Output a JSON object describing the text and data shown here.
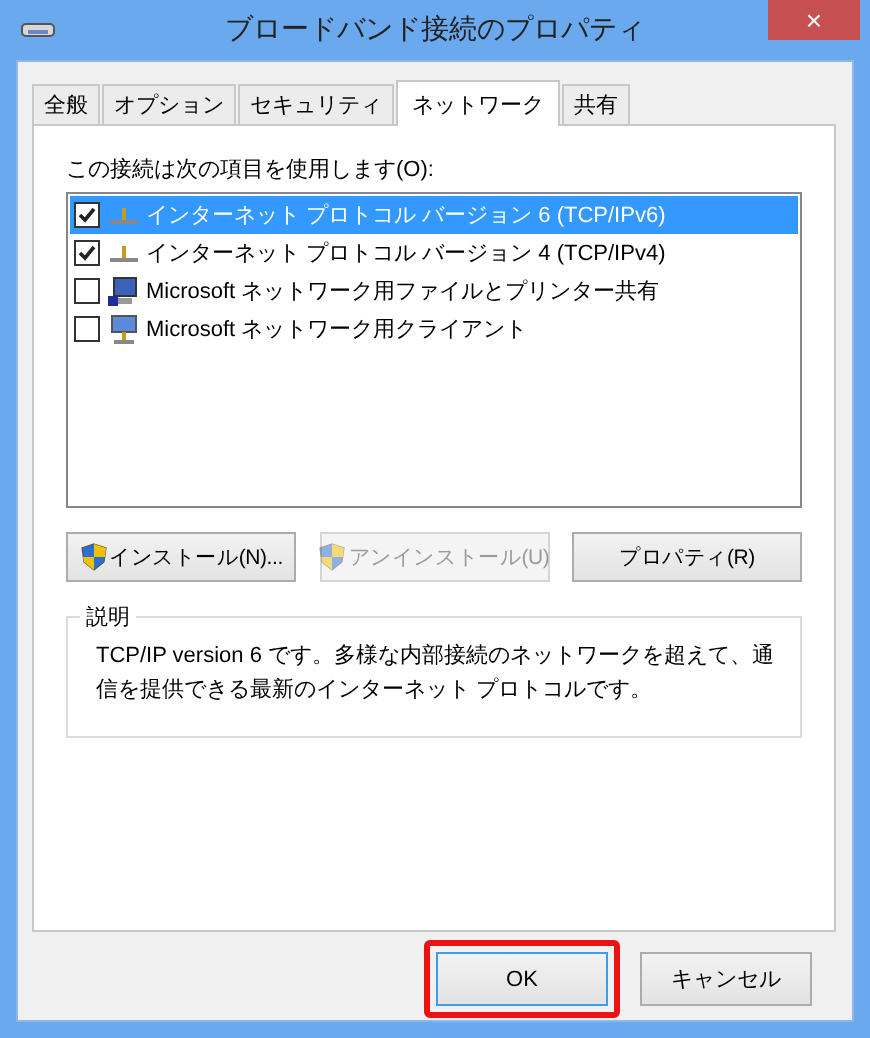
{
  "window": {
    "title": "ブロードバンド接続のプロパティ",
    "close_label": "×"
  },
  "tabs": [
    {
      "label": "全般",
      "selected": false
    },
    {
      "label": "オプション",
      "selected": false
    },
    {
      "label": "セキュリティ",
      "selected": false
    },
    {
      "label": "ネットワーク",
      "selected": true
    },
    {
      "label": "共有",
      "selected": false
    }
  ],
  "items_label": "この接続は次の項目を使用します(O):",
  "items": [
    {
      "label": "インターネット プロトコル バージョン 6 (TCP/IPv6)",
      "checked": true,
      "selected": true,
      "kind": "protocol"
    },
    {
      "label": "インターネット プロトコル バージョン 4 (TCP/IPv4)",
      "checked": true,
      "selected": false,
      "kind": "protocol"
    },
    {
      "label": "Microsoft ネットワーク用ファイルとプリンター共有",
      "checked": false,
      "selected": false,
      "kind": "service"
    },
    {
      "label": "Microsoft ネットワーク用クライアント",
      "checked": false,
      "selected": false,
      "kind": "client"
    }
  ],
  "item_buttons": [
    {
      "label": "インストール(N)...",
      "disabled": false,
      "shield": true
    },
    {
      "label": "アンインストール(U)",
      "disabled": true,
      "shield": true
    },
    {
      "label": "プロパティ(R)",
      "disabled": false,
      "shield": false
    }
  ],
  "description": {
    "title": "説明",
    "text": "TCP/IP version 6 です。多様な内部接続のネットワークを超えて、通信を提供できる最新のインターネット プロトコルです。"
  },
  "buttons": [
    {
      "label": "OK",
      "highlighted": true
    },
    {
      "label": "キャンセル",
      "highlighted": false
    }
  ]
}
